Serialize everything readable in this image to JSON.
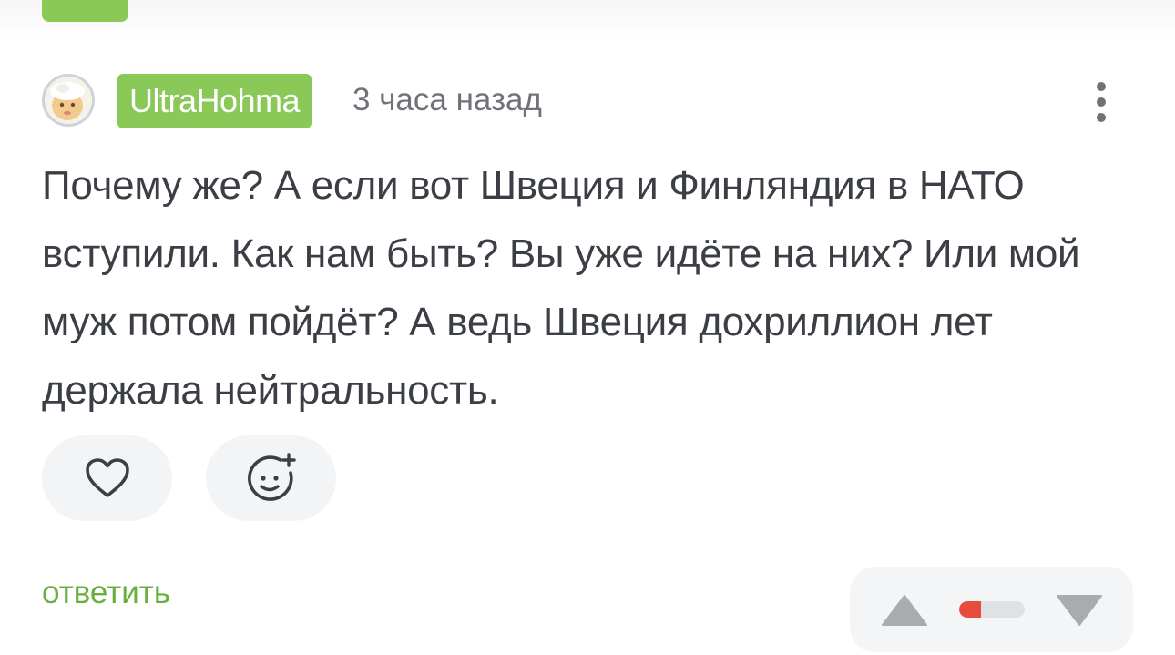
{
  "comment": {
    "author": "UltraHohma",
    "time": "3 часа назад",
    "text": "Почему же? А если вот Швеция и Финляндия в НАТО вступили. Как нам быть? Вы уже идёте на них? Или мой муж потом пойдёт? А ведь Швеция дохриллион лет держала нейтральность.",
    "reply_label": "ответить",
    "rating_positive_fraction": 0.33
  },
  "icons": {
    "like": "heart-icon",
    "react": "emoji-add-icon",
    "more": "more-vertical-icon",
    "vote_up": "triangle-up-icon",
    "vote_down": "triangle-down-icon"
  },
  "colors": {
    "accent_green": "#8ac858",
    "link_green": "#6aae3d",
    "text": "#3b3f45",
    "muted": "#6f7378",
    "rating_negative": "#e74c3c",
    "button_bg": "#f3f4f6"
  }
}
